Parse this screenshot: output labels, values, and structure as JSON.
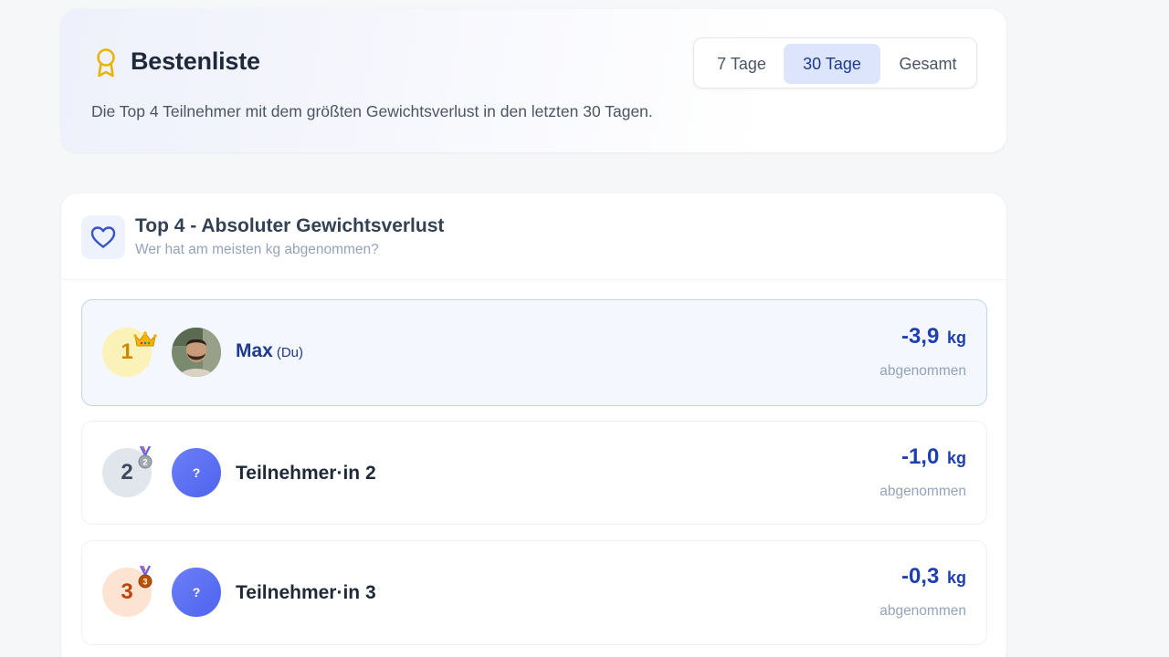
{
  "header": {
    "title": "Bestenliste",
    "subtitle": "Die Top 4 Teilnehmer mit dem größten Gewichtsverlust in den letzten 30 Tagen.",
    "icon": "award-icon",
    "accent_color": "#eab308",
    "range_tabs": [
      {
        "label": "7 Tage",
        "active": false
      },
      {
        "label": "30 Tage",
        "active": true
      },
      {
        "label": "Gesamt",
        "active": false
      }
    ]
  },
  "ranking": {
    "title": "Top 4 - Absoluter Gewichtsverlust",
    "subtitle": "Wer hat am meisten kg abgenommen?",
    "icon": "heart-icon",
    "entries": [
      {
        "rank": "1",
        "name": "Max",
        "you_tag": "(Du)",
        "loss": "-3,9",
        "unit": "kg",
        "loss_label": "abgenommen",
        "badge": "crown-icon",
        "avatar": "photo"
      },
      {
        "rank": "2",
        "name": "Teilnehmer·in 2",
        "loss": "-1,0",
        "unit": "kg",
        "loss_label": "abgenommen",
        "badge": "silver-medal-icon",
        "avatar_text": "?"
      },
      {
        "rank": "3",
        "name": "Teilnehmer·in 3",
        "loss": "-0,3",
        "unit": "kg",
        "loss_label": "abgenommen",
        "badge": "bronze-medal-icon",
        "avatar_text": "?"
      }
    ]
  }
}
